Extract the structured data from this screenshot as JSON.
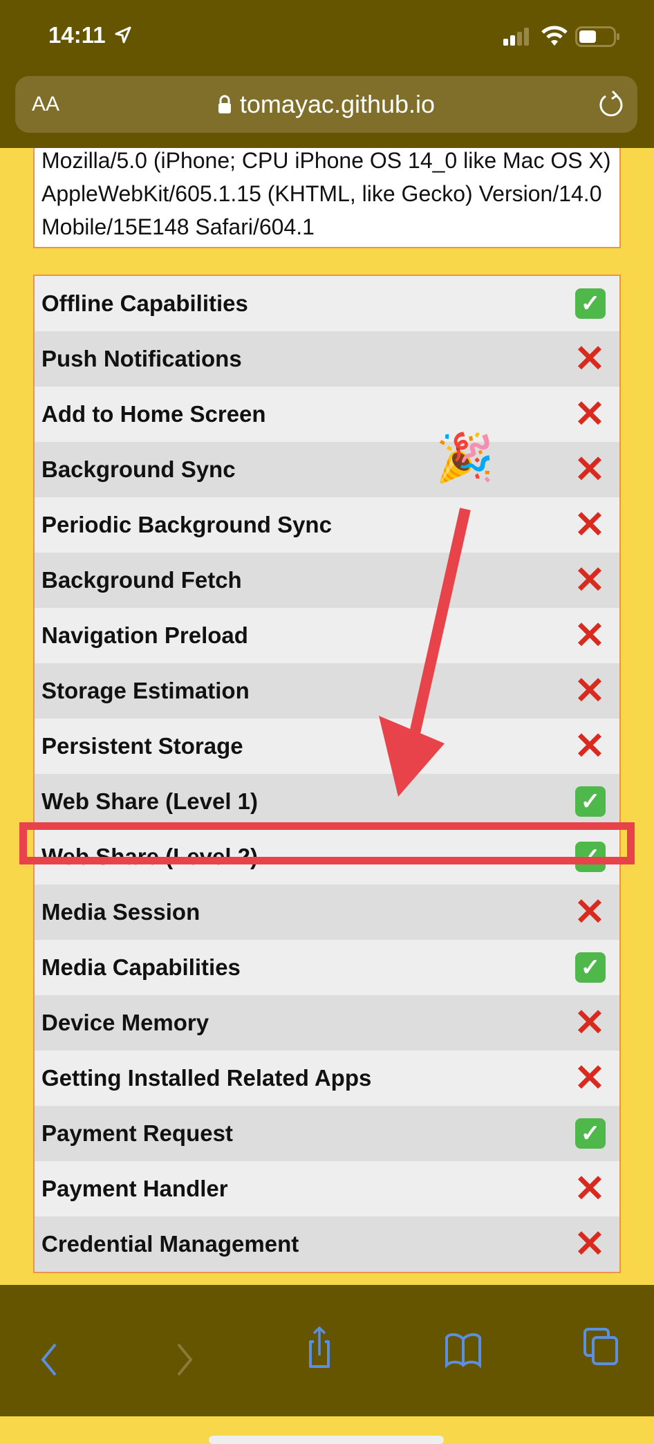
{
  "status_bar": {
    "time": "14:11"
  },
  "address_bar": {
    "text_size_label": "AA",
    "url": "tomayac.github.io"
  },
  "user_agent": "Mozilla/5.0 (iPhone; CPU iPhone OS 14_0 like Mac OS X) AppleWebKit/605.1.15 (KHTML, like Gecko) Version/14.0 Mobile/15E148 Safari/604.1",
  "features": [
    {
      "name": "Offline Capabilities",
      "supported": true
    },
    {
      "name": "Push Notifications",
      "supported": false
    },
    {
      "name": "Add to Home Screen",
      "supported": false
    },
    {
      "name": "Background Sync",
      "supported": false
    },
    {
      "name": "Periodic Background Sync",
      "supported": false
    },
    {
      "name": "Background Fetch",
      "supported": false
    },
    {
      "name": "Navigation Preload",
      "supported": false
    },
    {
      "name": "Storage Estimation",
      "supported": false
    },
    {
      "name": "Persistent Storage",
      "supported": false
    },
    {
      "name": "Web Share (Level 1)",
      "supported": true
    },
    {
      "name": "Web Share (Level 2)",
      "supported": true,
      "highlighted": true
    },
    {
      "name": "Media Session",
      "supported": false
    },
    {
      "name": "Media Capabilities",
      "supported": true
    },
    {
      "name": "Device Memory",
      "supported": false
    },
    {
      "name": "Getting Installed Related Apps",
      "supported": false
    },
    {
      "name": "Payment Request",
      "supported": true
    },
    {
      "name": "Payment Handler",
      "supported": false
    },
    {
      "name": "Credential Management",
      "supported": false
    }
  ],
  "icons": {
    "supported": "check-mark-button",
    "unsupported": "cross-mark",
    "annotation": "party-popper"
  },
  "colors": {
    "bar": "#665500",
    "page": "#f8d84a",
    "highlight": "#e8434b",
    "toolbar_icon": "#5b8fe0"
  }
}
